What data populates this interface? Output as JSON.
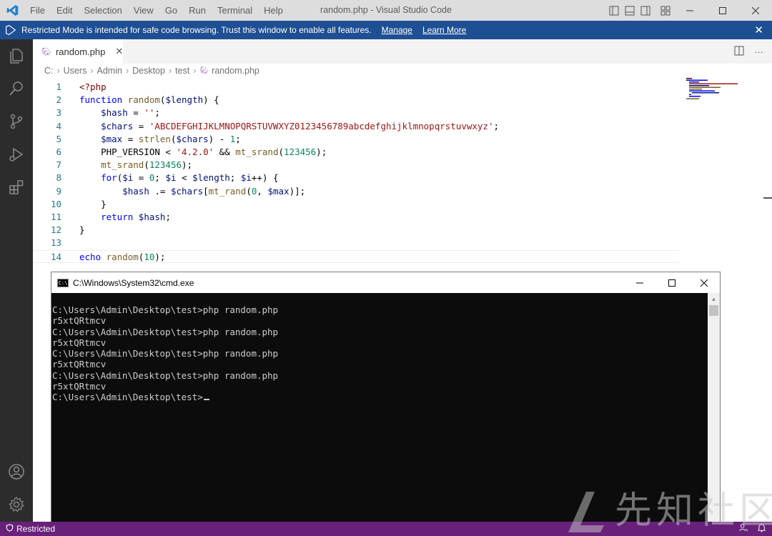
{
  "titlebar": {
    "menu": [
      "File",
      "Edit",
      "Selection",
      "View",
      "Go",
      "Run",
      "Terminal",
      "Help"
    ],
    "title": "random.php - Visual Studio Code"
  },
  "banner": {
    "message": "Restricted Mode is intended for safe code browsing. Trust this window to enable all features.",
    "manage": "Manage",
    "learn_more": "Learn More"
  },
  "tab": {
    "label": "random.php"
  },
  "breadcrumb": [
    "C:",
    "Users",
    "Admin",
    "Desktop",
    "test",
    "random.php"
  ],
  "code_lines": [
    "<?php",
    "function random($length) {",
    "    $hash = '';",
    "    $chars = 'ABCDEFGHIJKLMNOPQRSTUVWXYZ0123456789abcdefghijklmnopqrstuvwxyz';",
    "    $max = strlen($chars) - 1;",
    "    PHP_VERSION < '4.2.0' && mt_srand(123456);",
    "    mt_srand(123456);",
    "    for($i = 0; $i < $length; $i++) {",
    "        $hash .= $chars[mt_rand(0, $max)];",
    "    }",
    "    return $hash;",
    "}",
    "",
    "echo random(10);"
  ],
  "line_numbers": [
    "1",
    "2",
    "3",
    "4",
    "5",
    "6",
    "7",
    "8",
    "9",
    "10",
    "11",
    "12",
    "13",
    "14"
  ],
  "cmd": {
    "title": "C:\\Windows\\System32\\cmd.exe",
    "icon_text": "C:\\",
    "lines": [
      "C:\\Users\\Admin\\Desktop\\test>php random.php",
      "r5xtQRtmcv",
      "C:\\Users\\Admin\\Desktop\\test>php random.php",
      "r5xtQRtmcv",
      "C:\\Users\\Admin\\Desktop\\test>php random.php",
      "r5xtQRtmcv",
      "C:\\Users\\Admin\\Desktop\\test>php random.php",
      "r5xtQRtmcv",
      "C:\\Users\\Admin\\Desktop\\test>"
    ]
  },
  "statusbar": {
    "restricted": "Restricted"
  },
  "watermark": {
    "text": "先知社区"
  },
  "colors": {
    "banner": "#1f4f93",
    "activity_bar": "#2c2c2c",
    "status_bar": "#68217a",
    "cmd_bg": "#0c0c0c",
    "php_icon": "#a074c4"
  },
  "icons": {
    "activity": [
      "explorer-icon",
      "search-icon",
      "source-control-icon",
      "run-debug-icon",
      "extensions-icon",
      "account-icon",
      "manage-gear-icon"
    ]
  }
}
